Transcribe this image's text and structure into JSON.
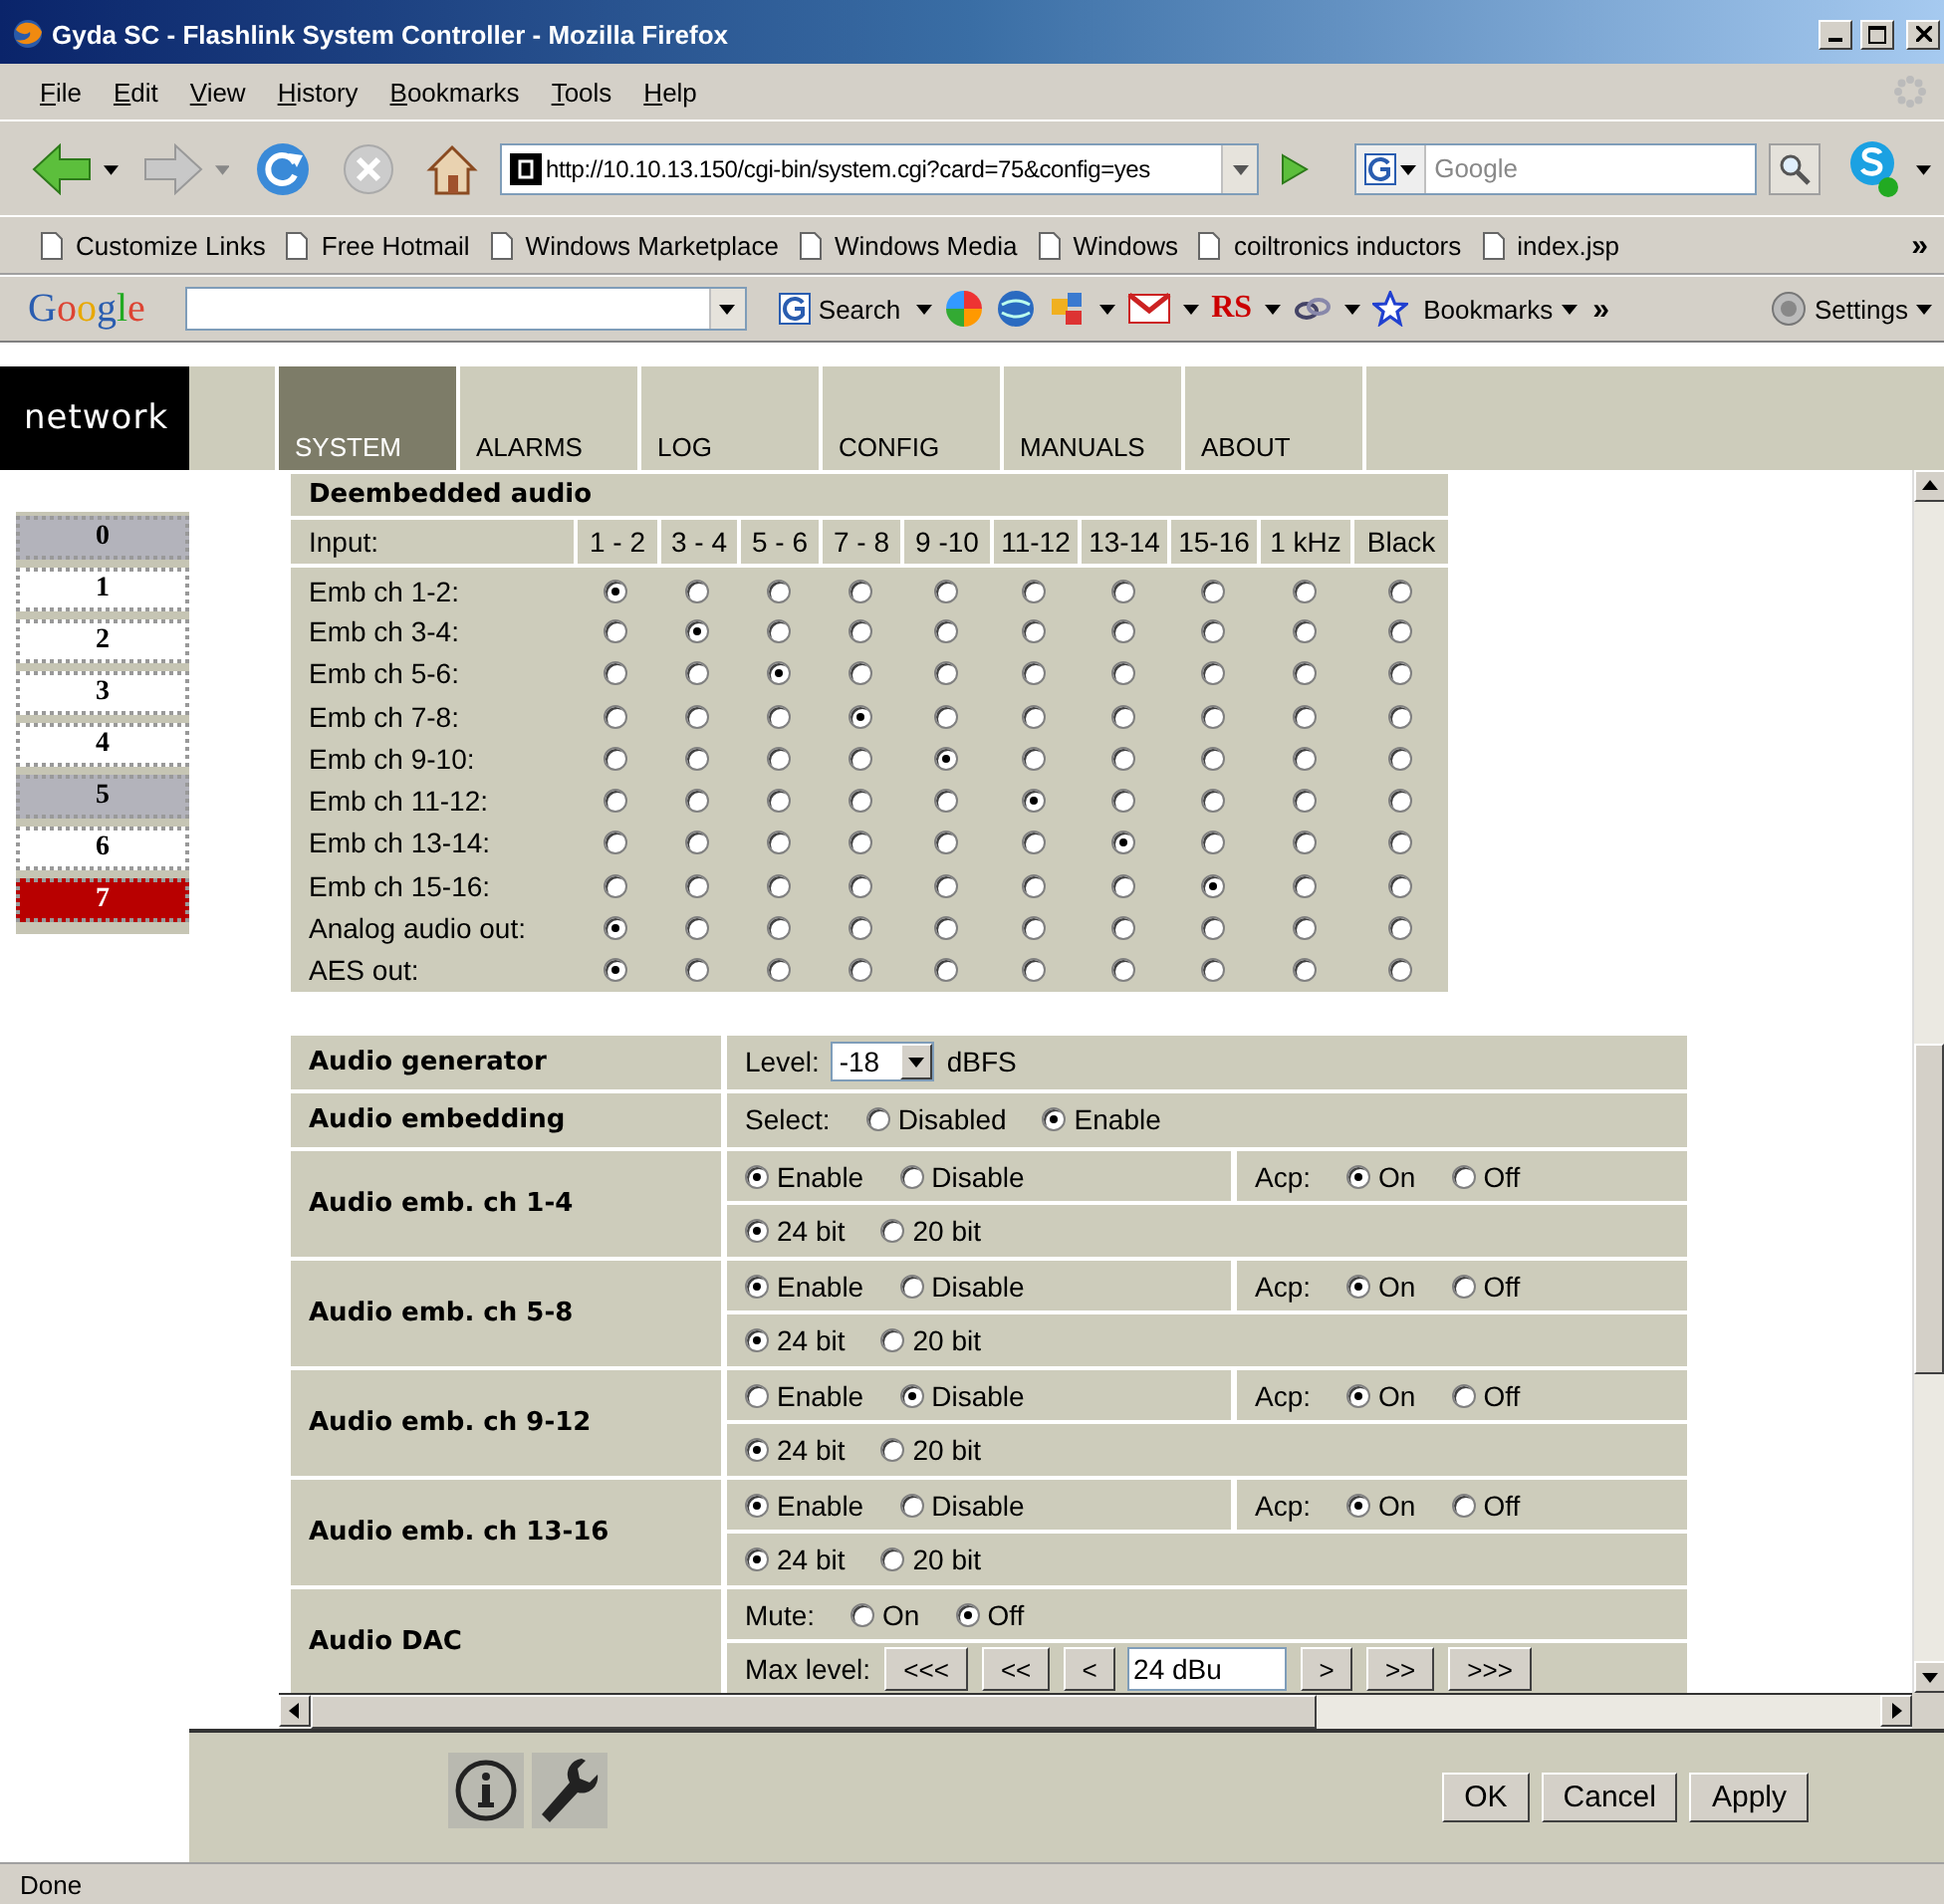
{
  "window": {
    "title": "Gyda SC - Flashlink System Controller - Mozilla Firefox"
  },
  "menu": [
    "File",
    "Edit",
    "View",
    "History",
    "Bookmarks",
    "Tools",
    "Help"
  ],
  "navigation": {
    "url": "http://10.10.13.150/cgi-bin/system.cgi?card=75&config=yes",
    "search": {
      "placeholder": "Google"
    }
  },
  "bookmarks": {
    "items": [
      "Customize Links",
      "Free Hotmail",
      "Windows Marketplace",
      "Windows Media",
      "Windows",
      "coiltronics inductors",
      "index.jsp"
    ],
    "overflow": "»"
  },
  "google_toolbar": {
    "logo": "Google",
    "search_button": "Search",
    "rs_button": "RS",
    "bookmarks_button": "Bookmarks",
    "more": "»",
    "settings_button": "Settings"
  },
  "page": {
    "logo": "network",
    "tabs": [
      {
        "label": "SYSTEM",
        "selected": true
      },
      {
        "label": "ALARMS",
        "selected": false
      },
      {
        "label": "LOG",
        "selected": false
      },
      {
        "label": "CONFIG",
        "selected": false
      },
      {
        "label": "MANUALS",
        "selected": false
      },
      {
        "label": "ABOUT",
        "selected": false
      }
    ],
    "cards": [
      {
        "label": "0",
        "kind": "empty",
        "selected": false
      },
      {
        "label": "1",
        "kind": "card",
        "selected": false
      },
      {
        "label": "2",
        "kind": "card",
        "selected": false
      },
      {
        "label": "3",
        "kind": "card",
        "selected": false
      },
      {
        "label": "4",
        "kind": "card",
        "selected": false
      },
      {
        "label": "5",
        "kind": "empty",
        "selected": false
      },
      {
        "label": "6",
        "kind": "card",
        "selected": false
      },
      {
        "label": "7",
        "kind": "card",
        "selected": true
      }
    ]
  },
  "deembedded": {
    "title": "Deembedded audio",
    "input_label": "Input:",
    "columns": [
      "1 - 2",
      "3 - 4",
      "5 - 6",
      "7 - 8",
      "9 -10",
      "11-12",
      "13-14",
      "15-16",
      "1 kHz",
      "Black"
    ],
    "rows": [
      {
        "label": "Emb ch 1-2:",
        "selected": [
          true,
          false,
          false,
          false,
          false,
          false,
          false,
          false,
          false,
          false
        ]
      },
      {
        "label": "Emb ch 3-4:",
        "selected": [
          false,
          true,
          false,
          false,
          false,
          false,
          false,
          false,
          false,
          false
        ]
      },
      {
        "label": "Emb ch 5-6:",
        "selected": [
          false,
          false,
          true,
          false,
          false,
          false,
          false,
          false,
          false,
          false
        ]
      },
      {
        "label": "Emb ch 7-8:",
        "selected": [
          false,
          false,
          false,
          true,
          false,
          false,
          false,
          false,
          false,
          false
        ]
      },
      {
        "label": "Emb ch 9-10:",
        "selected": [
          false,
          false,
          false,
          false,
          true,
          false,
          false,
          false,
          false,
          false
        ]
      },
      {
        "label": "Emb ch 11-12:",
        "selected": [
          false,
          false,
          false,
          false,
          false,
          true,
          false,
          false,
          false,
          false
        ]
      },
      {
        "label": "Emb ch 13-14:",
        "selected": [
          false,
          false,
          false,
          false,
          false,
          false,
          true,
          false,
          false,
          false
        ]
      },
      {
        "label": "Emb ch 15-16:",
        "selected": [
          false,
          false,
          false,
          false,
          false,
          false,
          false,
          true,
          false,
          false
        ]
      },
      {
        "label": "Analog audio out:",
        "selected": [
          true,
          false,
          false,
          false,
          false,
          false,
          false,
          false,
          false,
          false
        ]
      },
      {
        "label": "AES out:",
        "selected": [
          true,
          false,
          false,
          false,
          false,
          false,
          false,
          false,
          false,
          false
        ]
      }
    ]
  },
  "settings": [
    {
      "label": "Audio generator",
      "lines": [
        {
          "groups": [
            [
              {
                "kind": "text",
                "text": "Level:"
              },
              {
                "kind": "select",
                "value": "-18"
              },
              {
                "kind": "text",
                "text": "dBFS"
              }
            ]
          ]
        }
      ]
    },
    {
      "label": "Audio embedding",
      "lines": [
        {
          "groups": [
            [
              {
                "kind": "text",
                "text": "Select:"
              },
              {
                "kind": "radio",
                "label": "Disabled",
                "selected": false
              },
              {
                "kind": "radio",
                "label": "Enable",
                "selected": true
              }
            ]
          ]
        }
      ]
    },
    {
      "label": "Audio emb. ch 1-4",
      "lines": [
        {
          "groups": [
            [
              {
                "kind": "radio",
                "label": "Enable",
                "selected": true
              },
              {
                "kind": "radio",
                "label": "Disable",
                "selected": false
              }
            ],
            [
              {
                "kind": "text",
                "text": "Acp:"
              },
              {
                "kind": "radio",
                "label": "On",
                "selected": true
              },
              {
                "kind": "radio",
                "label": "Off",
                "selected": false
              }
            ]
          ]
        },
        {
          "groups": [
            [
              {
                "kind": "radio",
                "label": "24 bit",
                "selected": true
              },
              {
                "kind": "radio",
                "label": "20 bit",
                "selected": false
              }
            ]
          ]
        }
      ]
    },
    {
      "label": "Audio emb. ch 5-8",
      "lines": [
        {
          "groups": [
            [
              {
                "kind": "radio",
                "label": "Enable",
                "selected": true
              },
              {
                "kind": "radio",
                "label": "Disable",
                "selected": false
              }
            ],
            [
              {
                "kind": "text",
                "text": "Acp:"
              },
              {
                "kind": "radio",
                "label": "On",
                "selected": true
              },
              {
                "kind": "radio",
                "label": "Off",
                "selected": false
              }
            ]
          ]
        },
        {
          "groups": [
            [
              {
                "kind": "radio",
                "label": "24 bit",
                "selected": true
              },
              {
                "kind": "radio",
                "label": "20 bit",
                "selected": false
              }
            ]
          ]
        }
      ]
    },
    {
      "label": "Audio emb. ch 9-12",
      "lines": [
        {
          "groups": [
            [
              {
                "kind": "radio",
                "label": "Enable",
                "selected": false
              },
              {
                "kind": "radio",
                "label": "Disable",
                "selected": true
              }
            ],
            [
              {
                "kind": "text",
                "text": "Acp:"
              },
              {
                "kind": "radio",
                "label": "On",
                "selected": true
              },
              {
                "kind": "radio",
                "label": "Off",
                "selected": false
              }
            ]
          ]
        },
        {
          "groups": [
            [
              {
                "kind": "radio",
                "label": "24 bit",
                "selected": true
              },
              {
                "kind": "radio",
                "label": "20 bit",
                "selected": false
              }
            ]
          ]
        }
      ]
    },
    {
      "label": "Audio emb. ch 13-16",
      "lines": [
        {
          "groups": [
            [
              {
                "kind": "radio",
                "label": "Enable",
                "selected": true
              },
              {
                "kind": "radio",
                "label": "Disable",
                "selected": false
              }
            ],
            [
              {
                "kind": "text",
                "text": "Acp:"
              },
              {
                "kind": "radio",
                "label": "On",
                "selected": true
              },
              {
                "kind": "radio",
                "label": "Off",
                "selected": false
              }
            ]
          ]
        },
        {
          "groups": [
            [
              {
                "kind": "radio",
                "label": "24 bit",
                "selected": true
              },
              {
                "kind": "radio",
                "label": "20 bit",
                "selected": false
              }
            ]
          ]
        }
      ]
    },
    {
      "label": "Audio DAC",
      "lines": [
        {
          "groups": [
            [
              {
                "kind": "text",
                "text": "Mute:"
              },
              {
                "kind": "radio",
                "label": "On",
                "selected": false
              },
              {
                "kind": "radio",
                "label": "Off",
                "selected": true
              }
            ]
          ]
        },
        {
          "groups": [
            [
              {
                "kind": "text",
                "text": "Max level:"
              },
              {
                "kind": "button",
                "label": "<<<"
              },
              {
                "kind": "button",
                "label": "<<"
              },
              {
                "kind": "button",
                "label": "<"
              },
              {
                "kind": "input",
                "value": "24 dBu"
              },
              {
                "kind": "button",
                "label": ">"
              },
              {
                "kind": "button",
                "label": ">>"
              },
              {
                "kind": "button",
                "label": ">>>"
              }
            ]
          ]
        }
      ]
    }
  ],
  "footer": {
    "buttons": [
      "OK",
      "Cancel",
      "Apply"
    ]
  },
  "status_bar": "Done"
}
